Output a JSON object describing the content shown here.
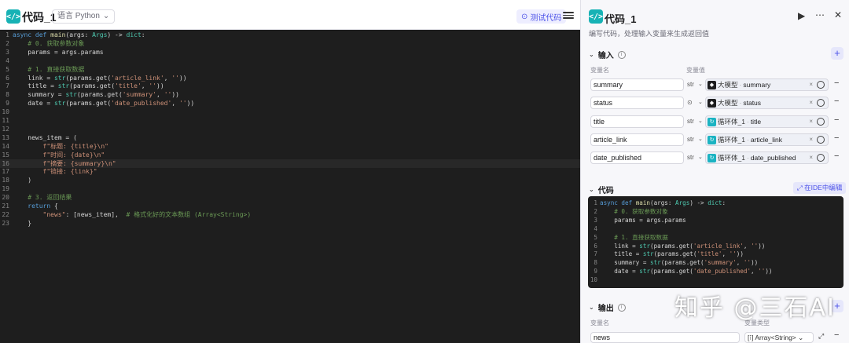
{
  "left": {
    "title": "代码_1",
    "language": "语言 Python",
    "test_button": "测试代码",
    "code_lines": [
      [
        {
          "t": "async def ",
          "c": "kw"
        },
        {
          "t": "main",
          "c": "fn"
        },
        {
          "t": "(args: "
        },
        {
          "t": "Args",
          "c": "ty"
        },
        {
          "t": ") -> "
        },
        {
          "t": "dict",
          "c": "ty"
        },
        {
          "t": ":"
        }
      ],
      [
        {
          "t": "    # 0. 获取参数对象",
          "c": "cm"
        }
      ],
      [
        {
          "t": "    params = args.params"
        }
      ],
      [
        {
          "t": ""
        }
      ],
      [
        {
          "t": "    # 1. 直接获取数据",
          "c": "cm"
        }
      ],
      [
        {
          "t": "    link = "
        },
        {
          "t": "str",
          "c": "ty"
        },
        {
          "t": "(params.get("
        },
        {
          "t": "'article_link'",
          "c": "str"
        },
        {
          "t": ", "
        },
        {
          "t": "''",
          "c": "str"
        },
        {
          "t": "))"
        }
      ],
      [
        {
          "t": "    title = "
        },
        {
          "t": "str",
          "c": "ty"
        },
        {
          "t": "(params.get("
        },
        {
          "t": "'title'",
          "c": "str"
        },
        {
          "t": ", "
        },
        {
          "t": "''",
          "c": "str"
        },
        {
          "t": "))"
        }
      ],
      [
        {
          "t": "    summary = "
        },
        {
          "t": "str",
          "c": "ty"
        },
        {
          "t": "(params.get("
        },
        {
          "t": "'summary'",
          "c": "str"
        },
        {
          "t": ", "
        },
        {
          "t": "''",
          "c": "str"
        },
        {
          "t": "))"
        }
      ],
      [
        {
          "t": "    date = "
        },
        {
          "t": "str",
          "c": "ty"
        },
        {
          "t": "(params.get("
        },
        {
          "t": "'date_published'",
          "c": "str"
        },
        {
          "t": ", "
        },
        {
          "t": "''",
          "c": "str"
        },
        {
          "t": "))"
        }
      ],
      [
        {
          "t": ""
        }
      ],
      [
        {
          "t": ""
        }
      ],
      [
        {
          "t": ""
        }
      ],
      [
        {
          "t": "    news_item = ("
        }
      ],
      [
        {
          "t": "        f\"标题: {title}\\n\"",
          "c": "str"
        }
      ],
      [
        {
          "t": "        f\"时间: {date}\\n\"",
          "c": "str"
        }
      ],
      [
        {
          "t": "        f\"摘要: {summary}\\n\"",
          "c": "str"
        }
      ],
      [
        {
          "t": "        f\"链接: {link}\"",
          "c": "str"
        }
      ],
      [
        {
          "t": "    )"
        }
      ],
      [
        {
          "t": ""
        }
      ],
      [
        {
          "t": "    # 3. 返回结果",
          "c": "cm"
        }
      ],
      [
        {
          "t": "    return",
          "c": "kw"
        },
        {
          "t": " {"
        }
      ],
      [
        {
          "t": "        "
        },
        {
          "t": "\"news\"",
          "c": "str"
        },
        {
          "t": ": [news_item],  "
        },
        {
          "t": "# 格式化好的文本数组 (Array<String>)",
          "c": "cm"
        }
      ],
      [
        {
          "t": "    }"
        }
      ]
    ],
    "active_line": 16
  },
  "right": {
    "title": "代码_1",
    "description": "编写代码，处理输入变量来生成返回值",
    "input_section": "输入",
    "col_var_name": "变量名",
    "col_var_value": "变量值",
    "inputs": [
      {
        "name": "summary",
        "type": "str",
        "source": "大模型",
        "variable": "summary",
        "icon": "dark"
      },
      {
        "name": "status",
        "type": "",
        "source": "大模型",
        "variable": "status",
        "icon": "dark"
      },
      {
        "name": "title",
        "type": "str",
        "source": "循环体_1",
        "variable": "title",
        "icon": "teal"
      },
      {
        "name": "article_link",
        "type": "str",
        "source": "循环体_1",
        "variable": "article_link",
        "icon": "teal"
      },
      {
        "name": "date_published",
        "type": "str",
        "source": "循环体_1",
        "variable": "date_published",
        "icon": "teal"
      }
    ],
    "code_section": "代码",
    "ide_button": "在IDE中编辑",
    "mini_code_lines": [
      [
        {
          "t": "async def ",
          "c": "kw"
        },
        {
          "t": "main",
          "c": "fn"
        },
        {
          "t": "(args: "
        },
        {
          "t": "Args",
          "c": "ty"
        },
        {
          "t": ") -> "
        },
        {
          "t": "dict",
          "c": "ty"
        },
        {
          "t": ":"
        }
      ],
      [
        {
          "t": "    # 0. 获取参数对象",
          "c": "cm"
        }
      ],
      [
        {
          "t": "    params = args.params"
        }
      ],
      [
        {
          "t": ""
        }
      ],
      [
        {
          "t": "    # 1. 直接获取数据",
          "c": "cm"
        }
      ],
      [
        {
          "t": "    link = "
        },
        {
          "t": "str",
          "c": "ty"
        },
        {
          "t": "(params.get("
        },
        {
          "t": "'article_link'",
          "c": "str"
        },
        {
          "t": ", "
        },
        {
          "t": "''",
          "c": "str"
        },
        {
          "t": "))"
        }
      ],
      [
        {
          "t": "    title = "
        },
        {
          "t": "str",
          "c": "ty"
        },
        {
          "t": "(params.get("
        },
        {
          "t": "'title'",
          "c": "str"
        },
        {
          "t": ", "
        },
        {
          "t": "''",
          "c": "str"
        },
        {
          "t": "))"
        }
      ],
      [
        {
          "t": "    summary = "
        },
        {
          "t": "str",
          "c": "ty"
        },
        {
          "t": "(params.get("
        },
        {
          "t": "'summary'",
          "c": "str"
        },
        {
          "t": ", "
        },
        {
          "t": "''",
          "c": "str"
        },
        {
          "t": "))"
        }
      ],
      [
        {
          "t": "    date = "
        },
        {
          "t": "str",
          "c": "ty"
        },
        {
          "t": "(params.get("
        },
        {
          "t": "'date_published'",
          "c": "str"
        },
        {
          "t": ", "
        },
        {
          "t": "''",
          "c": "str"
        },
        {
          "t": "))"
        }
      ],
      [
        {
          "t": ""
        }
      ]
    ],
    "output_section": "输出",
    "col_out_name": "变量名",
    "col_out_type": "变量类型",
    "output": {
      "name": "news",
      "type": "Array<String>"
    }
  },
  "watermark": "知乎 @三石AI",
  "colors": {
    "accent": "#4d53e8",
    "teal": "#17b2b5",
    "editor_bg": "#1e1e1e"
  }
}
